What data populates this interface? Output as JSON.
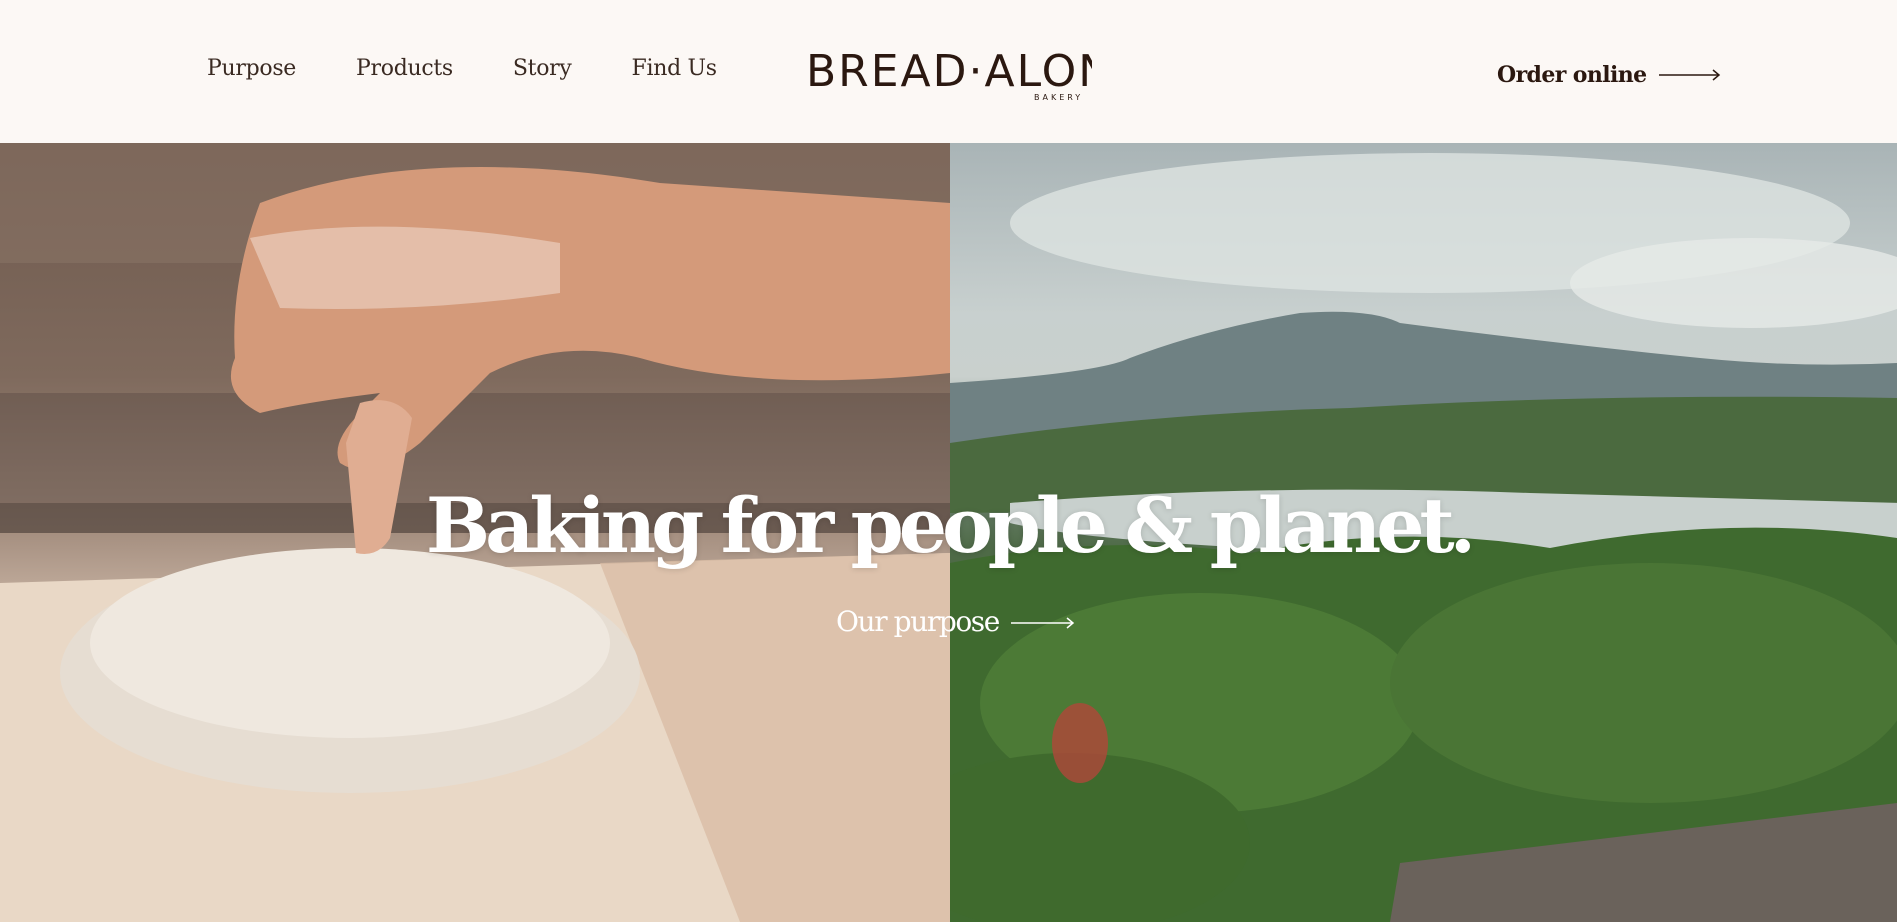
{
  "nav": {
    "items": [
      {
        "label": "Purpose"
      },
      {
        "label": "Products"
      },
      {
        "label": "Story"
      },
      {
        "label": "Find Us"
      }
    ]
  },
  "logo": {
    "wordmark": "BREAD·ALONE",
    "subtext": "BAKERY"
  },
  "header": {
    "order_label": "Order online"
  },
  "hero": {
    "title": "Baking for people & planet.",
    "cta_label": "Our purpose"
  },
  "icons": {
    "order_arrow": "arrow-right-icon",
    "cta_arrow": "arrow-right-icon"
  },
  "colors": {
    "background": "#fcf8f5",
    "text_dark": "#2b1810",
    "hero_text": "#ffffff"
  }
}
